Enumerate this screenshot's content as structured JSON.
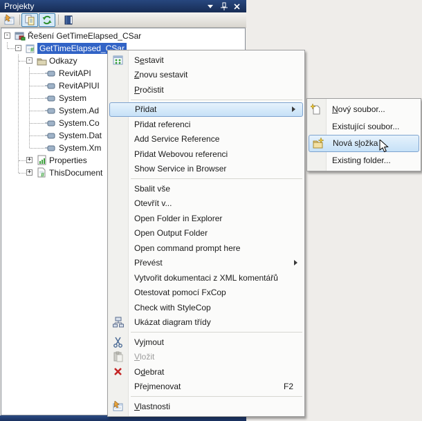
{
  "panel": {
    "title": "Projekty",
    "titlebar_icons": [
      "window-menu-icon",
      "pin-icon",
      "close-icon"
    ],
    "toolbar_icons": [
      "properties-icon",
      "show-all-files-icon",
      "refresh-icon",
      "book-icon"
    ]
  },
  "colors": {
    "titlebar": "#1f3a6d",
    "tree_selection": "#3163c6",
    "menu_highlight_border": "#7da2ce",
    "toolbar_toggle_border": "#3c7fb1"
  },
  "tree": {
    "items": [
      {
        "label": "Řešení GetTimeElapsed_CSar",
        "icon": "solution",
        "expander": "-"
      },
      {
        "label": "GetTimeElapsed_CSar",
        "icon": "csharp-project",
        "expander": "-",
        "selected": true
      },
      {
        "label": "Odkazy",
        "icon": "references-folder",
        "expander": "-"
      },
      {
        "label": "RevitAPI",
        "icon": "reference"
      },
      {
        "label": "RevitAPIUI",
        "icon": "reference"
      },
      {
        "label": "System",
        "icon": "reference"
      },
      {
        "label": "System.Ad",
        "icon": "reference"
      },
      {
        "label": "System.Co",
        "icon": "reference"
      },
      {
        "label": "System.Dat",
        "icon": "reference"
      },
      {
        "label": "System.Xm",
        "icon": "reference"
      },
      {
        "label": "Properties",
        "icon": "properties-node",
        "expander": "+"
      },
      {
        "label": "ThisDocument",
        "icon": "csharp-file",
        "expander": "+"
      }
    ]
  },
  "context_menu": {
    "items": [
      {
        "label": "Sestavit",
        "mn": 1,
        "icon": "build-icon"
      },
      {
        "label": "Znovu sestavit",
        "mn": 0
      },
      {
        "label": "Pročistit",
        "mn": 0
      },
      {
        "type": "separator"
      },
      {
        "label": "Přidat",
        "submenu": true,
        "highlighted": true
      },
      {
        "label": "Přidat referenci"
      },
      {
        "label": "Add Service Reference"
      },
      {
        "label": "Přidat Webovou referenci"
      },
      {
        "label": "Show Service in Browser"
      },
      {
        "type": "separator"
      },
      {
        "label": "Sbalit vše"
      },
      {
        "label": "Otevřít v..."
      },
      {
        "label": "Open Folder in Explorer"
      },
      {
        "label": "Open Output Folder"
      },
      {
        "label": "Open command prompt here"
      },
      {
        "label": "Převést",
        "submenu": true
      },
      {
        "label": "Vytvořit dokumentaci z XML komentářů"
      },
      {
        "label": "Otestovat pomocí FxCop"
      },
      {
        "label": "Check with StyleCop"
      },
      {
        "label": "Ukázat diagram třídy",
        "icon": "class-diagram-icon"
      },
      {
        "type": "separator"
      },
      {
        "label": "Vyjmout",
        "mn": 2,
        "icon": "cut-icon"
      },
      {
        "label": "Vložit",
        "mn": 0,
        "icon": "paste-icon",
        "disabled": true
      },
      {
        "label": "Odebrat",
        "mn": 1,
        "icon": "delete-icon"
      },
      {
        "label": "Přejmenovat",
        "mn": 3,
        "shortcut": "F2"
      },
      {
        "type": "separator"
      },
      {
        "label": "Vlastnosti",
        "mn": 0,
        "icon": "properties-icon"
      }
    ]
  },
  "submenu": {
    "items": [
      {
        "label": "Nový soubor...",
        "mn": 0,
        "icon": "new-file-icon"
      },
      {
        "label": "Existující soubor..."
      },
      {
        "label": "Nová složka",
        "mn": 6,
        "icon": "new-folder-icon",
        "highlighted": true
      },
      {
        "label": "Existing folder..."
      }
    ]
  }
}
